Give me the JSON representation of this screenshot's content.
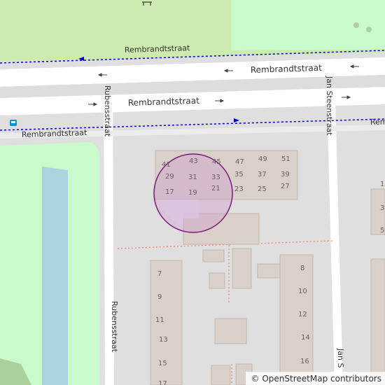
{
  "map": {
    "streets": {
      "rembrandt_north": "Rembrandtstraat",
      "rembrandt_center": "Rembrandtstraat",
      "rembrandt_south": "Rembrandtstraat",
      "rembrandt_left": "Rembrandtstraat",
      "rembrandt_right": "Rembrandtstraat",
      "rubens_upper": "Rubensstraat",
      "rubens_lower": "Rubensstraat",
      "jansteen_upper": "Jan Steenstraat",
      "jansteen_lower": "Jan S"
    },
    "house_numbers": [
      "41",
      "43",
      "45",
      "47",
      "49",
      "51",
      "29",
      "31",
      "33",
      "35",
      "37",
      "39",
      "17",
      "19",
      "21",
      "23",
      "25",
      "27",
      "7",
      "9",
      "11",
      "13",
      "15",
      "17",
      "8",
      "10",
      "12",
      "14",
      "16",
      "1",
      "3",
      "5"
    ],
    "attribution": "© OpenStreetMap contributors",
    "icons": [
      "bus-stop-icon",
      "bench-icon",
      "one-way-arrow-icon"
    ],
    "colors": {
      "background": "#e0dfdf",
      "park": "#c8facc",
      "water": "#aad3df",
      "building": "#d9d0c9",
      "road": "#ffffff",
      "marker_fill": "#cc99cc",
      "marker_stroke": "#7a1a7a",
      "bus_route": "#0000cc",
      "footpath": "#fa8072",
      "tree": "#add19e"
    }
  }
}
